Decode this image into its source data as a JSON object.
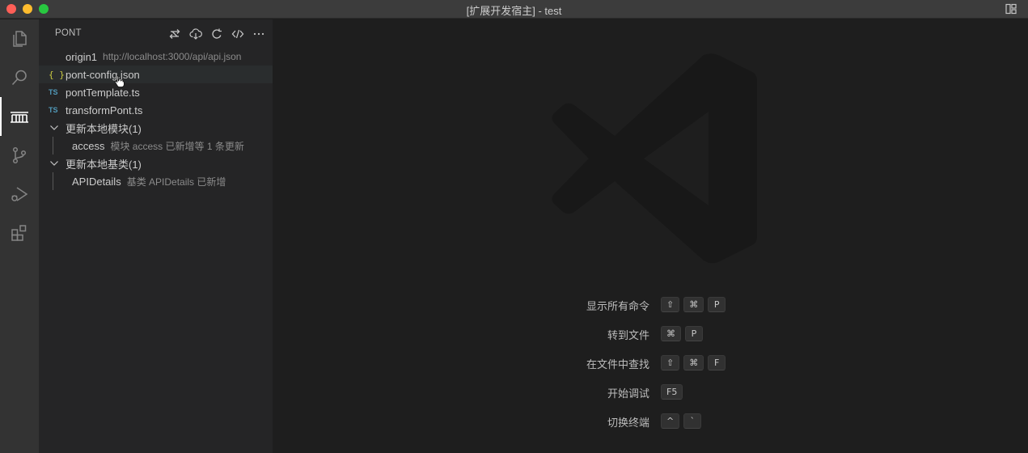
{
  "window": {
    "title": "[扩展开发宿主] - test",
    "traffic_colors": {
      "close": "#ff5f57",
      "minimize": "#febc2e",
      "maximize": "#28c840"
    }
  },
  "activity_bar": {
    "items": [
      {
        "icon": "files-icon",
        "active": false
      },
      {
        "icon": "search-icon",
        "active": false
      },
      {
        "icon": "pont-bridge-icon",
        "active": true
      },
      {
        "icon": "source-control-icon",
        "active": false
      },
      {
        "icon": "run-debug-icon",
        "active": false
      },
      {
        "icon": "extensions-icon",
        "active": false
      }
    ]
  },
  "sidebar": {
    "title": "PONT",
    "actions": [
      "switch-origin-icon",
      "cloud-download-icon",
      "refresh-icon",
      "code-icon",
      "more-icon"
    ],
    "tree": [
      {
        "label": "origin1",
        "description": "http://localhost:3000/api/api.json",
        "icon": "none"
      },
      {
        "label": "pont-config.json",
        "icon": "json-icon",
        "icon_text": "{ }"
      },
      {
        "label": "pontTemplate.ts",
        "icon": "ts-icon",
        "icon_text": "TS"
      },
      {
        "label": "transformPont.ts",
        "icon": "ts-icon",
        "icon_text": "TS"
      },
      {
        "label": "更新本地模块(1)",
        "icon": "chevron-down-icon"
      },
      {
        "label": "access",
        "description": "模块 access 已新增等 1 条更新",
        "icon": "none"
      },
      {
        "label": "更新本地基类(1)",
        "icon": "chevron-down-icon"
      },
      {
        "label": "APIDetails",
        "description": "基类 APIDetails 已新增",
        "icon": "none"
      }
    ]
  },
  "editor": {
    "watermark": "vscode-logo-icon",
    "shortcuts": [
      {
        "label": "显示所有命令",
        "keys": [
          "⇧",
          "⌘",
          "P"
        ]
      },
      {
        "label": "转到文件",
        "keys": [
          "⌘",
          "P"
        ]
      },
      {
        "label": "在文件中查找",
        "keys": [
          "⇧",
          "⌘",
          "F"
        ]
      },
      {
        "label": "开始调试",
        "keys": [
          "F5"
        ]
      },
      {
        "label": "切换终端",
        "keys": [
          "^",
          "`"
        ]
      }
    ]
  },
  "colors": {
    "titlebar": "#3c3c3c",
    "activitybar": "#333333",
    "sidebar": "#252526",
    "editor": "#1e1e1e",
    "ts_icon": "#519aba",
    "json_icon": "#cbcb41"
  }
}
